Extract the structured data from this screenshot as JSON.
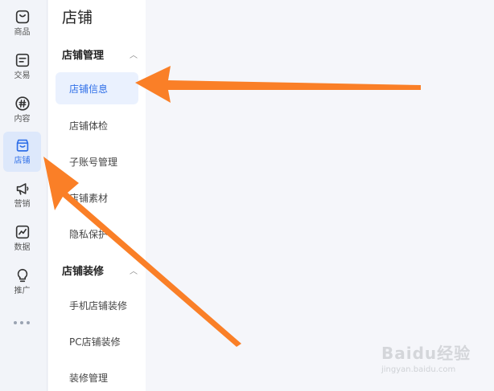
{
  "rail": {
    "items": [
      {
        "label": "商品",
        "icon": "product-box-icon"
      },
      {
        "label": "交易",
        "icon": "order-list-icon"
      },
      {
        "label": "内容",
        "icon": "hashtag-icon"
      },
      {
        "label": "店铺",
        "icon": "storefront-icon"
      },
      {
        "label": "营销",
        "icon": "megaphone-icon"
      },
      {
        "label": "数据",
        "icon": "chart-trend-icon"
      },
      {
        "label": "推广",
        "icon": "lightbulb-icon"
      }
    ],
    "active_index": 3,
    "active_color": "#2f6fe8"
  },
  "subnav": {
    "title": "店铺",
    "groups": [
      {
        "label": "店铺管理",
        "expanded": true,
        "items": [
          "店铺信息",
          "店铺体检",
          "子账号管理",
          "店铺素材",
          "隐私保护"
        ]
      },
      {
        "label": "店铺装修",
        "expanded": true,
        "items": [
          "手机店铺装修",
          "PC店铺装修",
          "装修管理"
        ]
      }
    ],
    "active_item": "店铺信息"
  },
  "annotation": {
    "arrow_color": "#fa7f27"
  },
  "watermark": {
    "brand": "Baidu经验",
    "url": "jingyan.baidu.com"
  }
}
